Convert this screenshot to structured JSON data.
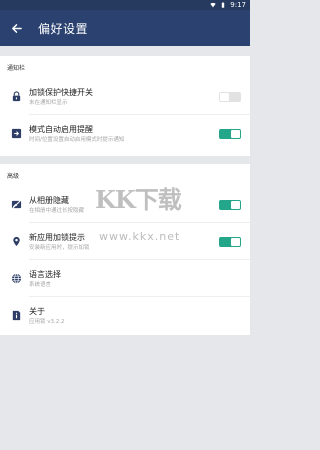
{
  "status_bar": {
    "time": "9:17",
    "icons": [
      "wifi-icon",
      "battery-icon"
    ]
  },
  "app_bar": {
    "back_icon": "back-arrow-icon",
    "title": "偏好设置"
  },
  "sections": [
    {
      "header": "通知栏",
      "items": [
        {
          "icon": "lock-icon",
          "title": "加锁保护快捷开关",
          "subtitle": "未在通知栏显示",
          "toggle": false
        },
        {
          "icon": "enter-icon",
          "title": "模式自动启用提醒",
          "subtitle": "时间/位置设置自动启用模式时提示通知",
          "toggle": true
        }
      ]
    },
    {
      "header": "高级",
      "items": [
        {
          "icon": "hide-image-icon",
          "title": "从相册隐藏",
          "subtitle": "在相册中通过长按隐藏",
          "toggle": true
        },
        {
          "icon": "new-app-lock-icon",
          "title": "新应用加锁提示",
          "subtitle": "安装新应用时，提示加锁",
          "toggle": true
        },
        {
          "icon": "globe-icon",
          "title": "语言选择",
          "subtitle": "系统语言",
          "toggle": null
        },
        {
          "icon": "info-document-icon",
          "title": "关于",
          "subtitle": "应用锁 v3.2.2",
          "toggle": null
        }
      ]
    }
  ],
  "watermark": {
    "main": "KK下载",
    "sub": "www.kkx.net"
  },
  "colors": {
    "app_bar": "#2b4270",
    "status_bar": "#253a5e",
    "toggle_on": "#24a68a",
    "toggle_off": "#e2e2e2",
    "icon": "#2e3e66",
    "background": "#e6e7ea"
  }
}
